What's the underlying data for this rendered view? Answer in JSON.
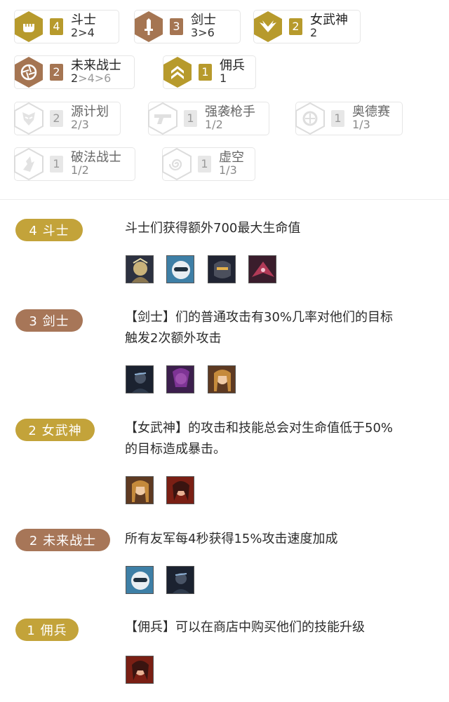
{
  "traits": {
    "active": [
      {
        "name": "斗士",
        "count": "4",
        "thresholds_current": "2>4",
        "thresholds_rest": "",
        "tier": "gold",
        "icon": "fist-icon"
      },
      {
        "name": "剑士",
        "count": "3",
        "thresholds_current": "3>6",
        "thresholds_rest": "",
        "tier": "bronze",
        "icon": "sword-icon"
      },
      {
        "name": "女武神",
        "count": "2",
        "thresholds_current": "2",
        "thresholds_rest": "",
        "tier": "gold",
        "icon": "wings-icon"
      },
      {
        "name": "未来战士",
        "count": "2",
        "thresholds_current": "2",
        "thresholds_rest": ">4>6",
        "tier": "bronze",
        "icon": "aperture-icon"
      },
      {
        "name": "佣兵",
        "count": "1",
        "thresholds_current": "1",
        "thresholds_rest": "",
        "tier": "gold",
        "icon": "chevrons-icon"
      }
    ],
    "inactive": [
      {
        "name": "源计划",
        "count": "2",
        "thresholds": "2/3",
        "icon": "mask-icon"
      },
      {
        "name": "强袭枪手",
        "count": "1",
        "thresholds": "1/2",
        "icon": "gun-icon"
      },
      {
        "name": "奥德赛",
        "count": "1",
        "thresholds": "1/3",
        "icon": "helmet-icon"
      },
      {
        "name": "破法战士",
        "count": "1",
        "thresholds": "1/2",
        "icon": "flame-icon"
      },
      {
        "name": "虚空",
        "count": "1",
        "thresholds": "1/3",
        "icon": "spiral-icon"
      }
    ]
  },
  "details": [
    {
      "label": "4 斗士",
      "tier": "gold",
      "lines": [
        "斗士们获得额外700最大生命值"
      ],
      "champions": [
        "champion-1",
        "champion-2",
        "champion-3",
        "champion-4"
      ]
    },
    {
      "label": "3 剑士",
      "tier": "bronze",
      "lines": [
        "【剑士】们的普通攻击有30%几率对他们的目标",
        "触发2次额外攻击"
      ],
      "champions": [
        "champion-5",
        "champion-6",
        "champion-7"
      ]
    },
    {
      "label": "2 女武神",
      "tier": "gold",
      "lines": [
        "【女武神】的攻击和技能总会对生命值低于50%",
        "的目标造成暴击。"
      ],
      "champions": [
        "champion-7",
        "champion-8"
      ]
    },
    {
      "label": "2 未来战士",
      "tier": "bronze",
      "lines": [
        "所有友军每4秒获得15%攻击速度加成"
      ],
      "champions": [
        "champion-2",
        "champion-5"
      ]
    },
    {
      "label": "1 佣兵",
      "tier": "gold",
      "lines": [
        "【佣兵】可以在商店中购买他们的技能升级"
      ],
      "champions": [
        "champion-8"
      ]
    }
  ],
  "colors": {
    "gold": "#c3a33a",
    "bronze": "#a77658",
    "inactive": "#e7e7e7"
  }
}
